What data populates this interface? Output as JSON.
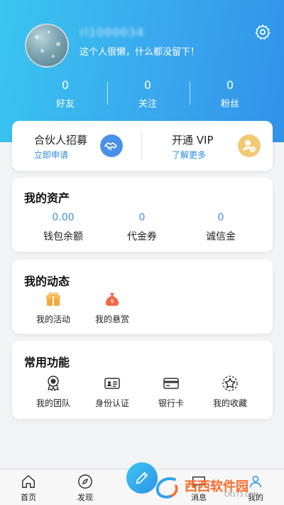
{
  "profile": {
    "username": "rl1000034",
    "bio": "这个人很懒，什么都没留下！"
  },
  "stats": [
    {
      "value": "0",
      "label": "好友"
    },
    {
      "value": "0",
      "label": "关注"
    },
    {
      "value": "0",
      "label": "粉丝"
    }
  ],
  "promo": {
    "partner": {
      "title": "合伙人招募",
      "sub": "立即申请",
      "icon": "handshake-icon"
    },
    "vip": {
      "title": "开通 VIP",
      "sub": "了解更多",
      "icon": "vip-user-icon"
    }
  },
  "assets": {
    "title": "我的资产",
    "items": [
      {
        "value": "0.00",
        "label": "钱包余额"
      },
      {
        "value": "0",
        "label": "代金券"
      },
      {
        "value": "0",
        "label": "诚信金"
      }
    ]
  },
  "activity": {
    "title": "我的动态",
    "items": [
      {
        "label": "我的活动",
        "icon": "gift-icon"
      },
      {
        "label": "我的悬赏",
        "icon": "money-bag-icon"
      }
    ]
  },
  "functions": {
    "title": "常用功能",
    "items": [
      {
        "label": "我的团队",
        "icon": "badge-icon"
      },
      {
        "label": "身份认证",
        "icon": "id-card-icon"
      },
      {
        "label": "银行卡",
        "icon": "bank-card-icon"
      },
      {
        "label": "我的收藏",
        "icon": "star-icon"
      }
    ]
  },
  "tabbar": [
    {
      "label": "首页",
      "icon": "home-icon"
    },
    {
      "label": "发现",
      "icon": "compass-icon"
    },
    {
      "label": "消息",
      "icon": "message-icon"
    },
    {
      "label": "我的",
      "icon": "user-icon"
    }
  ],
  "watermark": {
    "brand": "西西软件园",
    "url": "CR173.COM"
  },
  "colors": {
    "header_start": "#39c6f0",
    "header_end": "#2f93ea",
    "accent_blue": "#2a8de6",
    "asset_value": "#3d8ed8"
  }
}
